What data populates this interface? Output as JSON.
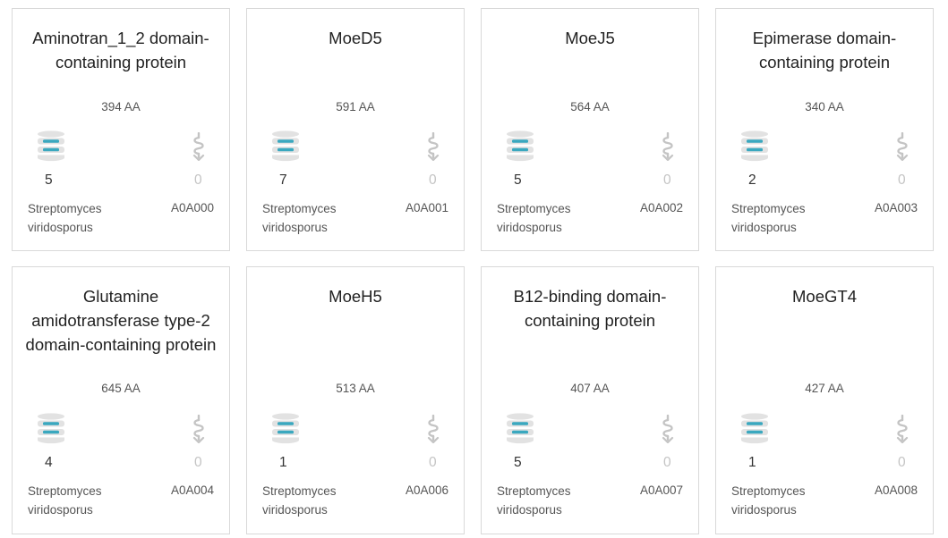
{
  "colors": {
    "db_gray": "#e2e2e2",
    "db_teal": "#3aa8bf",
    "struct_gray": "#c4c4c4"
  },
  "cards": [
    {
      "title": "Aminotran_1_2 domain-containing protein",
      "length": "394 AA",
      "count": "5",
      "structures": "0",
      "organism": "Streptomyces viridosporus",
      "accession": "A0A000"
    },
    {
      "title": "MoeD5",
      "length": "591 AA",
      "count": "7",
      "structures": "0",
      "organism": "Streptomyces viridosporus",
      "accession": "A0A001"
    },
    {
      "title": "MoeJ5",
      "length": "564 AA",
      "count": "5",
      "structures": "0",
      "organism": "Streptomyces viridosporus",
      "accession": "A0A002"
    },
    {
      "title": "Epimerase domain-containing protein",
      "length": "340 AA",
      "count": "2",
      "structures": "0",
      "organism": "Streptomyces viridosporus",
      "accession": "A0A003"
    },
    {
      "title": "Glutamine amidotransferase type-2 domain-containing protein",
      "length": "645 AA",
      "count": "4",
      "structures": "0",
      "organism": "Streptomyces viridosporus",
      "accession": "A0A004"
    },
    {
      "title": "MoeH5",
      "length": "513 AA",
      "count": "1",
      "structures": "0",
      "organism": "Streptomyces viridosporus",
      "accession": "A0A006"
    },
    {
      "title": "B12-binding domain-containing protein",
      "length": "407 AA",
      "count": "5",
      "structures": "0",
      "organism": "Streptomyces viridosporus",
      "accession": "A0A007"
    },
    {
      "title": "MoeGT4",
      "length": "427 AA",
      "count": "1",
      "structures": "0",
      "organism": "Streptomyces viridosporus",
      "accession": "A0A008"
    }
  ],
  "icons": {
    "database": "database-icon",
    "structure": "protein-structure-icon"
  }
}
